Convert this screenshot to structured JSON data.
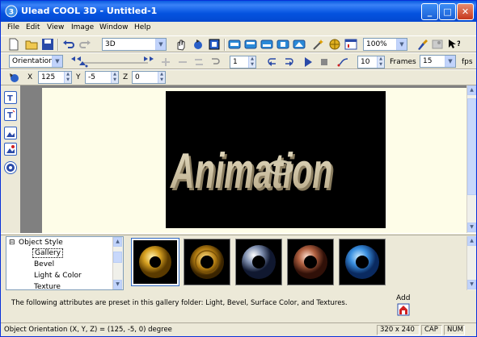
{
  "titlebar": {
    "title": "Ulead COOL 3D - Untitled-1",
    "minimize": "_",
    "maximize": "□",
    "close": "✕"
  },
  "menu": [
    "File",
    "Edit",
    "View",
    "Image",
    "Window",
    "Help"
  ],
  "toolbar1": {
    "object_combo": "3D",
    "zoom_combo": "100%"
  },
  "toolbar2": {
    "mode_combo": "Orientation",
    "frame_value": "1",
    "frame_total": "10",
    "frames_label": "Frames",
    "fps_value": "15",
    "fps_label": "fps"
  },
  "toolbar3": {
    "x_label": "X",
    "x_value": "125",
    "y_label": "Y",
    "y_value": "-5",
    "z_label": "Z",
    "z_value": "0"
  },
  "canvas": {
    "text": "Animation"
  },
  "tree": {
    "root": "Object Style",
    "items": [
      "Gallery",
      "Bevel",
      "Light & Color",
      "Texture"
    ],
    "selected": "Gallery"
  },
  "gallery": {
    "thumbs": [
      "gold-torus",
      "gold-ring",
      "silver-torus",
      "copper-torus",
      "blue-torus"
    ]
  },
  "description": "The following attributes are preset in this gallery folder: Light, Bevel, Surface Color, and Textures.",
  "add_label": "Add",
  "status": {
    "message": "Object Orientation (X, Y, Z) = (125, -5, 0) degree",
    "size": "320 x 240",
    "caps": "CAP",
    "num": "NUM"
  },
  "colors": {
    "title_blue": "#0453e0",
    "canvas_bg": "#000000",
    "text_3d": "#d8cfb2"
  }
}
